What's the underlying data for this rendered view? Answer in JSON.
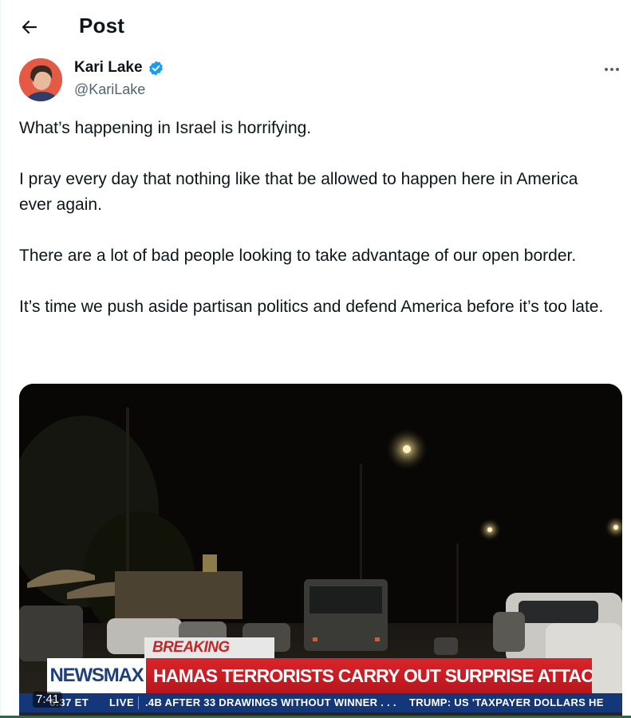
{
  "header": {
    "title": "Post"
  },
  "author": {
    "name": "Kari Lake",
    "handle": "@KariLake",
    "verified": true,
    "verified_color": "#1d9bf0"
  },
  "post": {
    "paragraphs": [
      "What’s happening in Israel is horrifying.",
      "I pray every day that nothing like that be allowed to happen here in America ever again.",
      "There are a lot of bad people looking to take advantage of our open border.",
      "It’s time we push aside partisan politics and defend America before it’s too late."
    ]
  },
  "media": {
    "type": "video",
    "duration": "7:41",
    "broadcast": {
      "breaking": "BREAKING NEWS",
      "network": "NEWSMAX",
      "headline": "HAMAS TERRORISTS CARRY OUT SURPRISE ATTACK IN ISRAEL",
      "clock": "6:37 ET",
      "live": "LIVE",
      "ticker_1": ".4B AFTER 33 DRAWINGS WITHOUT WINNER . . .",
      "ticker_2": "TRUMP: US 'TAXPAYER DOLLARS HE"
    }
  },
  "colors": {
    "text": "#0f1419",
    "secondary": "#536471",
    "newsmax_red": "#d8252b",
    "newsmax_blue": "#14377a"
  },
  "icons": {
    "back": "arrow-left-icon",
    "more": "more-horizontal-icon",
    "verified": "verified-badge-icon"
  }
}
